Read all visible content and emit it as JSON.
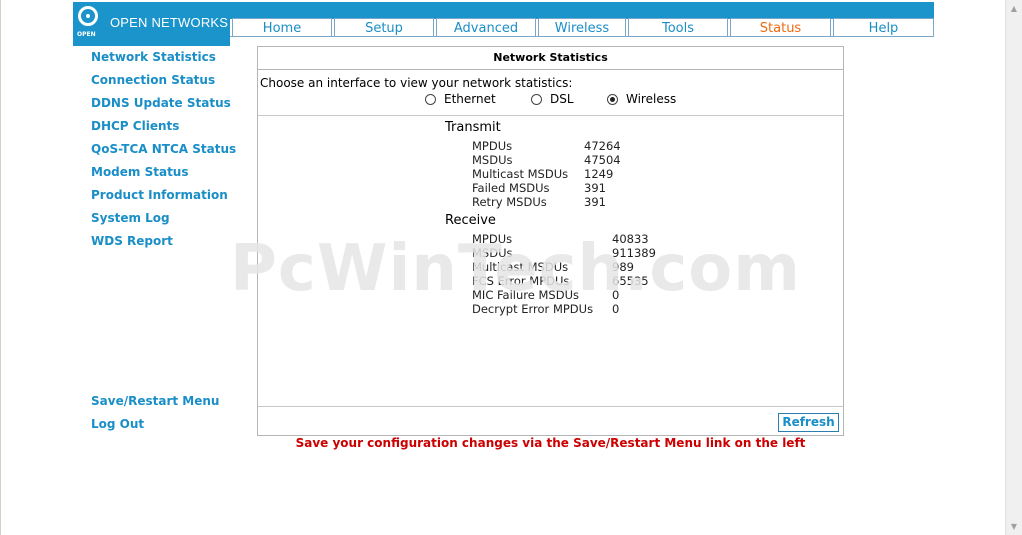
{
  "brand": {
    "logo_small": "OPEN",
    "name": "OPEN NETWORKS"
  },
  "nav": {
    "tabs": [
      {
        "label": "Home"
      },
      {
        "label": "Setup"
      },
      {
        "label": "Advanced"
      },
      {
        "label": "Wireless"
      },
      {
        "label": "Tools"
      },
      {
        "label": "Status"
      },
      {
        "label": "Help"
      }
    ],
    "active_tab": "Status",
    "colors": {
      "tab_text": "#1a8ec7",
      "active_tab_text": "#ee6a10",
      "band": "#1b94cb"
    }
  },
  "sidebar": {
    "items": [
      {
        "label": "Network Statistics"
      },
      {
        "label": "Connection Status"
      },
      {
        "label": "DDNS Update Status"
      },
      {
        "label": "DHCP Clients"
      },
      {
        "label": "QoS-TCA NTCA Status"
      },
      {
        "label": "Modem Status"
      },
      {
        "label": "Product Information"
      },
      {
        "label": "System Log"
      },
      {
        "label": "WDS Report"
      }
    ],
    "bottom_items": [
      {
        "label": "Save/Restart Menu"
      },
      {
        "label": "Log Out"
      }
    ]
  },
  "panel": {
    "title": "Network Statistics",
    "prompt": "Choose an interface to view your network statistics:",
    "interfaces": [
      {
        "label": "Ethernet",
        "checked": false
      },
      {
        "label": "DSL",
        "checked": false
      },
      {
        "label": "Wireless",
        "checked": true
      }
    ],
    "transmit": {
      "heading": "Transmit",
      "rows": [
        {
          "label": "MPDUs",
          "value": "47264"
        },
        {
          "label": "MSDUs",
          "value": "47504"
        },
        {
          "label": "Multicast MSDUs",
          "value": "1249"
        },
        {
          "label": "Failed MSDUs",
          "value": "391"
        },
        {
          "label": "Retry MSDUs",
          "value": "391"
        }
      ]
    },
    "receive": {
      "heading": "Receive",
      "rows": [
        {
          "label": "MPDUs",
          "value": "40833"
        },
        {
          "label": "MSDUs",
          "value": "911389"
        },
        {
          "label": "Multicast MSDUs",
          "value": "989"
        },
        {
          "label": "FCS Error MPDUs",
          "value": "65535"
        },
        {
          "label": "MIC Failure MSDUs",
          "value": "0"
        },
        {
          "label": "Decrypt Error MPDUs",
          "value": "0"
        }
      ]
    },
    "refresh_label": "Refresh"
  },
  "warning": "Save your configuration changes via the Save/Restart Menu link on the left",
  "watermark": "PcWinTech.com"
}
